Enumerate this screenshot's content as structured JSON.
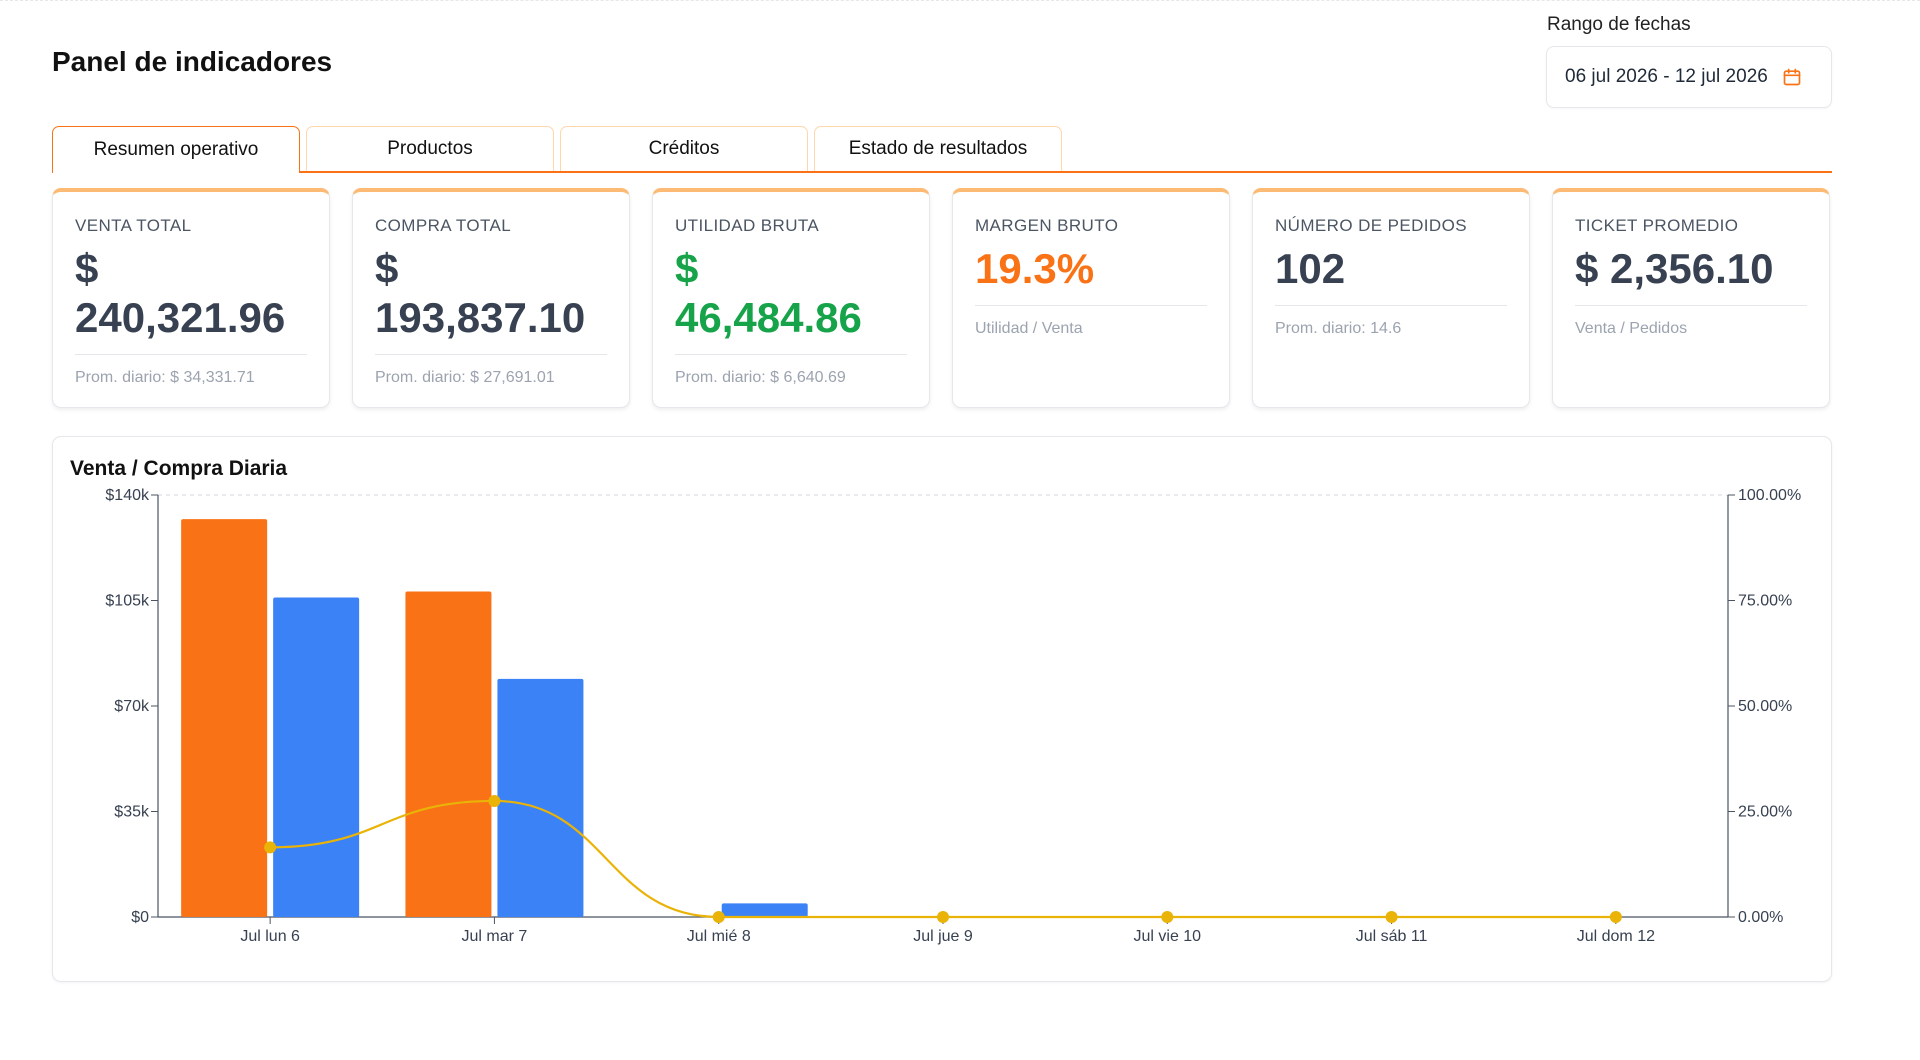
{
  "page": {
    "title": "Panel de indicadores"
  },
  "date_range": {
    "label": "Rango de fechas",
    "value": "06 jul 2026 - 12 jul 2026",
    "icon": "calendar-icon"
  },
  "tabs": [
    {
      "label": "Resumen operativo",
      "active": true
    },
    {
      "label": "Productos",
      "active": false
    },
    {
      "label": "Créditos",
      "active": false
    },
    {
      "label": "Estado de resultados",
      "active": false
    }
  ],
  "kpis": [
    {
      "label": "VENTA TOTAL",
      "value_line1": "$",
      "value_line2": "240,321.96",
      "sub": "Prom. diario: $ 34,331.71"
    },
    {
      "label": "COMPRA TOTAL",
      "value_line1": "$",
      "value_line2": "193,837.10",
      "sub": "Prom. diario: $ 27,691.01"
    },
    {
      "label": "UTILIDAD BRUTA",
      "value_line1": "$",
      "value_line2": "46,484.86",
      "sub": "Prom. diario: $ 6,640.69"
    },
    {
      "label": "MARGEN BRUTO",
      "value": "19.3%",
      "sub": "Utilidad / Venta"
    },
    {
      "label": "NÚMERO DE PEDIDOS",
      "value": "102",
      "sub": "Prom. diario: 14.6"
    },
    {
      "label": "TICKET PROMEDIO",
      "value": "$ 2,356.10",
      "sub": "Venta / Pedidos"
    }
  ],
  "colors": {
    "accent": "#f97316",
    "green": "#16a34a",
    "venta_bar": "#f97316",
    "compra_bar": "#3b82f6",
    "margin_line": "#eab308"
  },
  "chart_data": {
    "type": "bar",
    "title": "Venta / Compra Diaria",
    "categories": [
      "Jul lun 6",
      "Jul mar 7",
      "Jul mié 8",
      "Jul jue 9",
      "Jul vie 10",
      "Jul sáb 11",
      "Jul dom 12"
    ],
    "series": [
      {
        "type": "bar",
        "axis": "left",
        "color": "#f97316",
        "values": [
          132000,
          108000,
          0,
          0,
          0,
          0,
          0
        ]
      },
      {
        "type": "bar",
        "axis": "left",
        "color": "#3b82f6",
        "values": [
          106000,
          79000,
          4500,
          0,
          0,
          0,
          0
        ]
      },
      {
        "type": "line",
        "axis": "right",
        "color": "#eab308",
        "values": [
          16.5,
          27.5,
          0,
          0,
          0,
          0,
          0
        ]
      }
    ],
    "y_left": {
      "min": 0,
      "max": 140000,
      "ticks": [
        0,
        35000,
        70000,
        105000,
        140000
      ],
      "tick_labels": [
        "$0",
        "$35k",
        "$70k",
        "$105k",
        "$140k"
      ]
    },
    "y_right": {
      "min": 0,
      "max": 100,
      "ticks": [
        0,
        25,
        50,
        75,
        100
      ],
      "tick_labels": [
        "0.00%",
        "25.00%",
        "50.00%",
        "75.00%",
        "100.00%"
      ]
    },
    "xlabel": "",
    "ylabel": "",
    "grid": false,
    "legend": "none"
  }
}
